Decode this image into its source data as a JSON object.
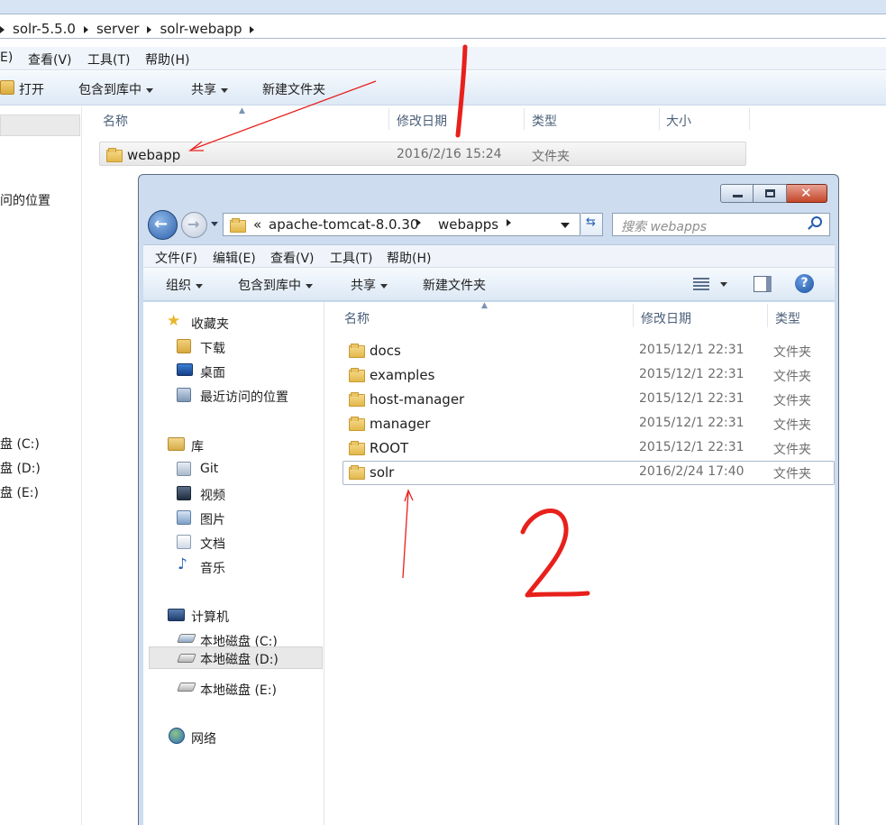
{
  "back_window": {
    "breadcrumb": [
      "solr-5.5.0",
      "server",
      "solr-webapp"
    ],
    "menu": [
      "E)",
      "查看(V)",
      "工具(T)",
      "帮助(H)"
    ],
    "toolbar": {
      "open": "打开",
      "include_library": "包含到库中",
      "share": "共享",
      "new_folder": "新建文件夹"
    },
    "columns": {
      "name": "名称",
      "date": "修改日期",
      "type": "类型",
      "size": "大小"
    },
    "row": {
      "name": "webapp",
      "date": "2016/2/16 15:24",
      "type": "文件夹"
    },
    "sidebar_partial": {
      "recent": "问的位置",
      "drive_c": "盘 (C:)",
      "drive_d": "盘 (D:)",
      "drive_e": "盘 (E:)"
    }
  },
  "front_window": {
    "address": {
      "chevron": "«",
      "crumbs": [
        "apache-tomcat-8.0.30",
        "webapps"
      ]
    },
    "search": {
      "placeholder": "搜索 webapps"
    },
    "menu": [
      "文件(F)",
      "编辑(E)",
      "查看(V)",
      "工具(T)",
      "帮助(H)"
    ],
    "toolbar": {
      "organize": "组织",
      "include_library": "包含到库中",
      "share": "共享",
      "new_folder": "新建文件夹"
    },
    "sidebar": {
      "favorites": "收藏夹",
      "downloads": "下载",
      "desktop": "桌面",
      "recent": "最近访问的位置",
      "libraries": "库",
      "git": "Git",
      "videos": "视频",
      "pictures": "图片",
      "documents": "文档",
      "music": "音乐",
      "computer": "计算机",
      "drive_c": "本地磁盘 (C:)",
      "drive_d": "本地磁盘 (D:)",
      "drive_e": "本地磁盘 (E:)",
      "network": "网络"
    },
    "columns": {
      "name": "名称",
      "date": "修改日期",
      "type": "类型"
    },
    "files": [
      {
        "name": "docs",
        "date": "2015/12/1 22:31",
        "type": "文件夹"
      },
      {
        "name": "examples",
        "date": "2015/12/1 22:31",
        "type": "文件夹"
      },
      {
        "name": "host-manager",
        "date": "2015/12/1 22:31",
        "type": "文件夹"
      },
      {
        "name": "manager",
        "date": "2015/12/1 22:31",
        "type": "文件夹"
      },
      {
        "name": "ROOT",
        "date": "2015/12/1 22:31",
        "type": "文件夹"
      },
      {
        "name": "solr",
        "date": "2016/2/24 17:40",
        "type": "文件夹"
      }
    ]
  },
  "annotations": {
    "mark_1": "1",
    "mark_2": "2",
    "color": "#e8201c"
  },
  "colors": {
    "chrome_blue": "#d3e3f5",
    "toolbar_top": "#f3f8fd",
    "toolbar_bottom": "#dbe8f6",
    "selection": "#e5f3fb"
  }
}
